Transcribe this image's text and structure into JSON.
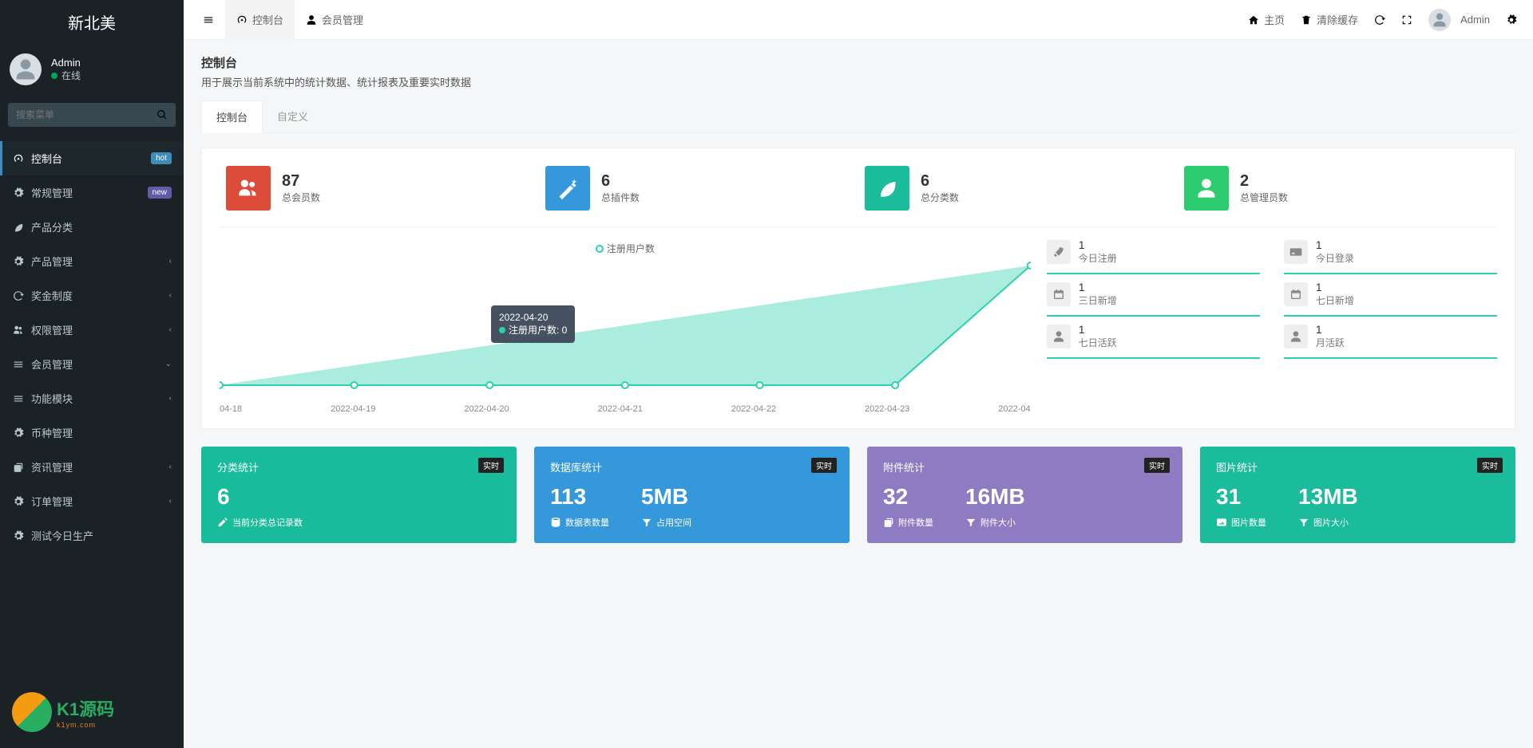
{
  "brand": "新北美",
  "user": {
    "name": "Admin",
    "status": "在线"
  },
  "search_placeholder": "搜索菜单",
  "sidebar": [
    {
      "label": "控制台",
      "badge": "hot",
      "badge_class": "badge-blue",
      "active": true,
      "icon": "dashboard"
    },
    {
      "label": "常规管理",
      "badge": "new",
      "badge_class": "badge-purple",
      "icon": "cogs"
    },
    {
      "label": "产品分类",
      "icon": "leaf"
    },
    {
      "label": "产品管理",
      "arrow": true,
      "icon": "diamond"
    },
    {
      "label": "奖金制度",
      "arrow": true,
      "icon": "recycle"
    },
    {
      "label": "权限管理",
      "arrow": true,
      "icon": "users"
    },
    {
      "label": "会员管理",
      "arrow_down": true,
      "icon": "list"
    },
    {
      "label": "功能模块",
      "arrow": true,
      "icon": "list"
    },
    {
      "label": "币种管理",
      "icon": "circle"
    },
    {
      "label": "资讯管理",
      "arrow": true,
      "icon": "news"
    },
    {
      "label": "订单管理",
      "arrow": true,
      "icon": "circle"
    },
    {
      "label": "测试今日生产",
      "icon": "circle"
    }
  ],
  "watermark": {
    "name": "K1源码",
    "sub": "k1ym.com"
  },
  "topbar": {
    "tabs": [
      {
        "label": "控制台",
        "icon": "dashboard",
        "active": true
      },
      {
        "label": "会员管理",
        "icon": "user"
      }
    ],
    "right": {
      "home": "主页",
      "clear_cache": "清除缓存",
      "user": "Admin"
    }
  },
  "page": {
    "title": "控制台",
    "subtitle": "用于展示当前系统中的统计数据、统计报表及重要实时数据",
    "tabs": [
      {
        "label": "控制台",
        "active": true
      },
      {
        "label": "自定义"
      }
    ]
  },
  "stats": [
    {
      "num": "87",
      "label": "总会员数",
      "color": "c-red",
      "icon": "users"
    },
    {
      "num": "6",
      "label": "总插件数",
      "color": "c-blue",
      "icon": "magic"
    },
    {
      "num": "6",
      "label": "总分类数",
      "color": "c-teal",
      "icon": "leaf"
    },
    {
      "num": "2",
      "label": "总管理员数",
      "color": "c-green",
      "icon": "user"
    }
  ],
  "chart_data": {
    "type": "area",
    "series_name": "注册用户数",
    "categories": [
      "04-18",
      "2022-04-19",
      "2022-04-20",
      "2022-04-21",
      "2022-04-22",
      "2022-04-23",
      "2022-04"
    ],
    "values": [
      0,
      0,
      0,
      0,
      0,
      0,
      86
    ],
    "tooltip": {
      "date": "2022-04-20",
      "label": "注册用户数: 0"
    },
    "color": "#2bd1b0"
  },
  "mini_stats_left": [
    {
      "n": "1",
      "l": "今日注册",
      "icon": "rocket"
    },
    {
      "n": "1",
      "l": "三日新增",
      "icon": "calendar"
    },
    {
      "n": "1",
      "l": "七日活跃",
      "icon": "user-circle"
    }
  ],
  "mini_stats_right": [
    {
      "n": "1",
      "l": "今日登录",
      "icon": "id-card"
    },
    {
      "n": "1",
      "l": "七日新增",
      "icon": "calendar-plus"
    },
    {
      "n": "1",
      "l": "月活跃",
      "icon": "user-circle"
    }
  ],
  "bottom_panels": [
    {
      "color": "bp-teal2",
      "title": "分类统计",
      "tag": "实时",
      "cols": [
        {
          "big": "6",
          "sm": "当前分类总记录数",
          "icon": "pencil"
        }
      ]
    },
    {
      "color": "bp-blue2",
      "title": "数据库统计",
      "tag": "实时",
      "cols": [
        {
          "big": "113",
          "sm": "数据表数量",
          "icon": "database"
        },
        {
          "big": "5MB",
          "sm": "占用空间",
          "icon": "filter"
        }
      ]
    },
    {
      "color": "bp-purple",
      "title": "附件统计",
      "tag": "实时",
      "cols": [
        {
          "big": "32",
          "sm": "附件数量",
          "icon": "copy"
        },
        {
          "big": "16MB",
          "sm": "附件大小",
          "icon": "filter"
        }
      ]
    },
    {
      "color": "bp-green2",
      "title": "图片统计",
      "tag": "实时",
      "cols": [
        {
          "big": "31",
          "sm": "图片数量",
          "icon": "image"
        },
        {
          "big": "13MB",
          "sm": "图片大小",
          "icon": "filter"
        }
      ]
    }
  ]
}
